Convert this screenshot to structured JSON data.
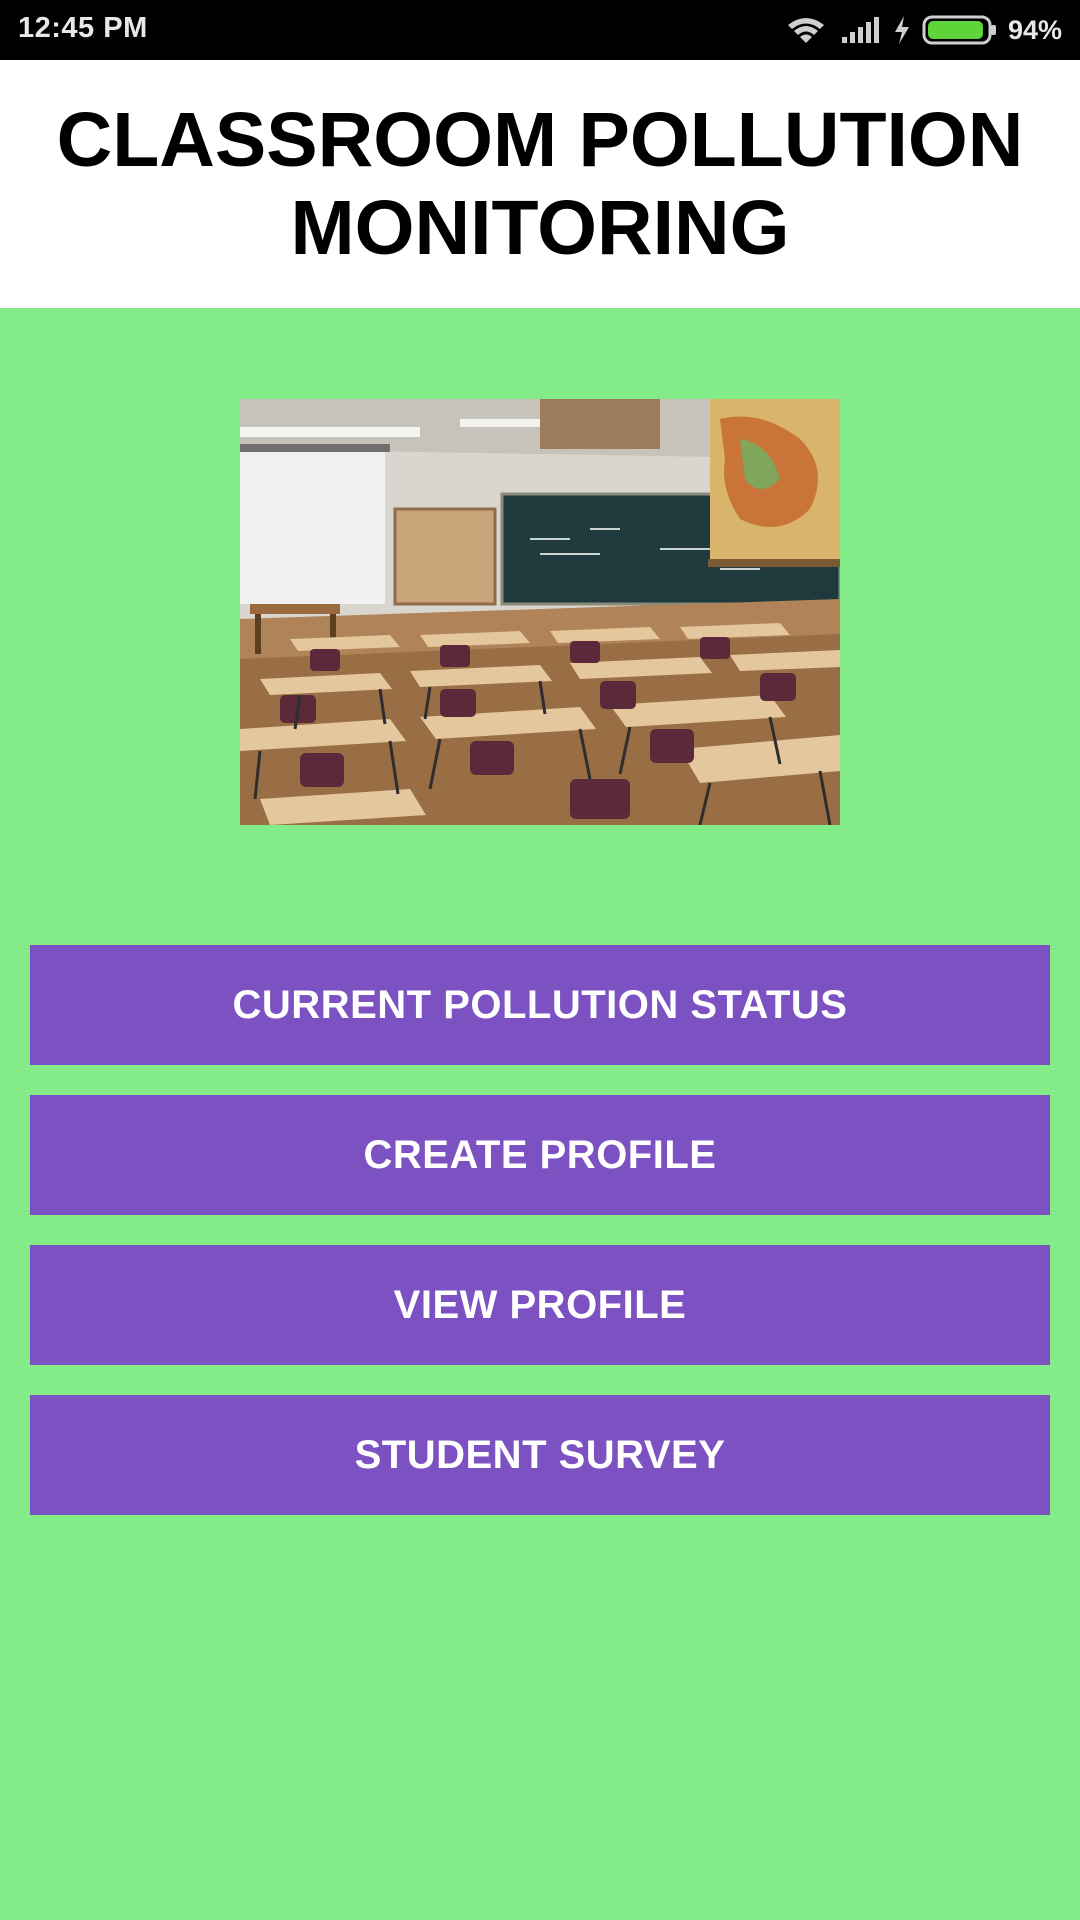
{
  "status_bar": {
    "time": "12:45 PM",
    "battery_percent": "94%",
    "battery_level": 0.94,
    "icons": [
      "wifi-icon",
      "signal-icon",
      "charging-icon",
      "battery-icon"
    ]
  },
  "header": {
    "title": "CLASSROOM POLLUTION MONITORING"
  },
  "hero": {
    "image": "classroom-photo"
  },
  "menu": {
    "buttons": [
      {
        "label": "CURRENT POLLUTION STATUS"
      },
      {
        "label": "CREATE PROFILE"
      },
      {
        "label": "VIEW PROFILE"
      },
      {
        "label": "STUDENT SURVEY"
      }
    ]
  },
  "colors": {
    "background": "#83eb88",
    "button": "#7c51c1",
    "header_bg": "#ffffff",
    "status_bar": "#000000",
    "battery_fill": "#5fd33a"
  }
}
